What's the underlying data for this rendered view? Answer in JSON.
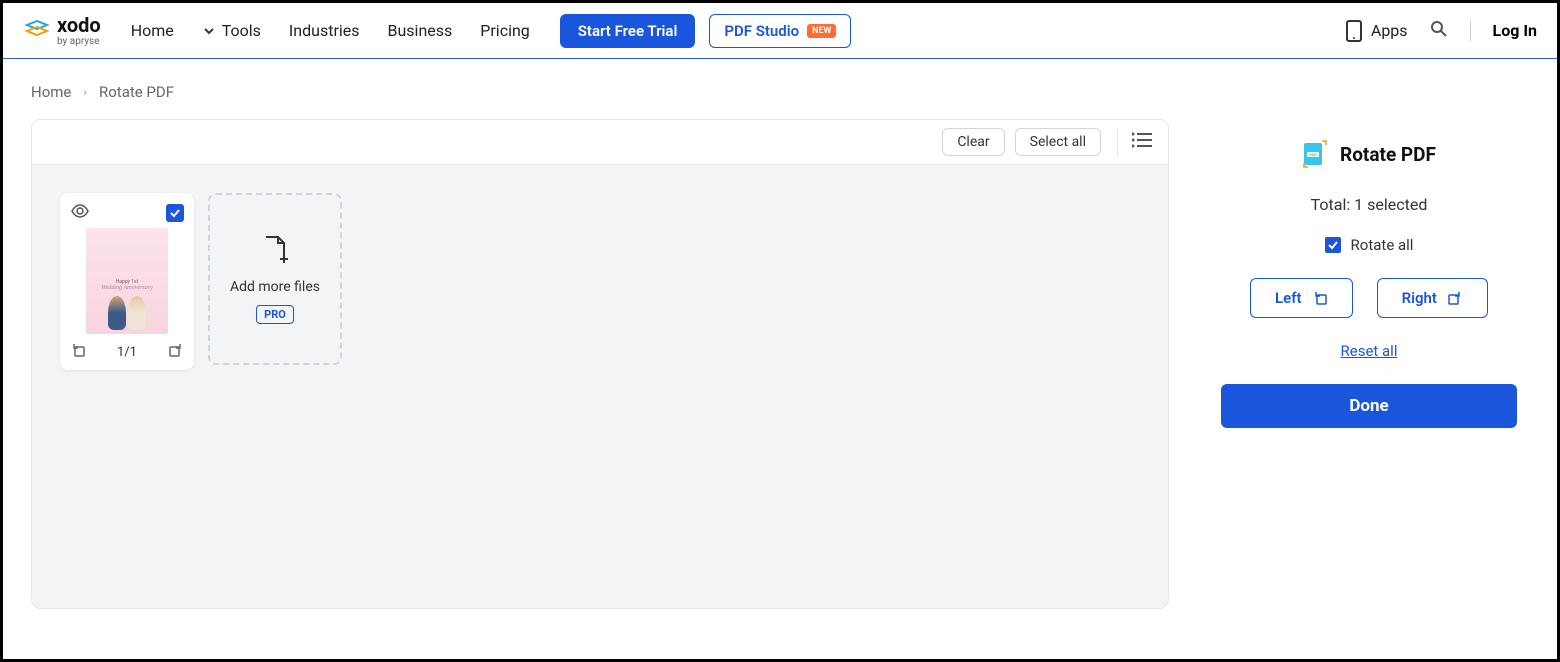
{
  "header": {
    "brand": "xodo",
    "brand_sub": "by apryse",
    "nav": {
      "home": "Home",
      "tools": "Tools",
      "industries": "Industries",
      "business": "Business",
      "pricing": "Pricing"
    },
    "cta_trial": "Start Free Trial",
    "cta_studio": "PDF Studio",
    "badge_new": "NEW",
    "apps": "Apps",
    "login": "Log In"
  },
  "breadcrumb": {
    "home": "Home",
    "current": "Rotate PDF"
  },
  "toolbar": {
    "clear": "Clear",
    "select_all": "Select all"
  },
  "thumbnail": {
    "page_indicator": "1/1",
    "doc_line1": "Happy 1st",
    "doc_line2": "Wedding Anniversary"
  },
  "add_card": {
    "label": "Add more files",
    "pro": "PRO"
  },
  "sidebar": {
    "title": "Rotate PDF",
    "total": "Total: 1 selected",
    "rotate_all": "Rotate all",
    "left": "Left",
    "right": "Right",
    "reset": "Reset all",
    "done": "Done"
  }
}
